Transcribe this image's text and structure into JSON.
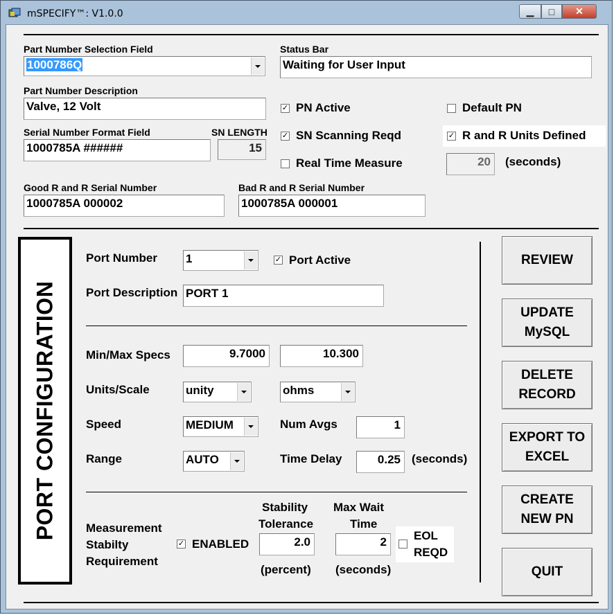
{
  "window": {
    "title": "mSPECIFY™: V1.0.0",
    "minimize_glyph": "▁",
    "maximize_glyph": "□",
    "close_glyph": "✕",
    "icon": "app-icon"
  },
  "header": {
    "part_number_label": "Part Number Selection Field",
    "part_number_value": "1000786Q",
    "status_bar_label": "Status Bar",
    "status_bar_value": "Waiting for User Input",
    "pn_description_label": "Part Number Description",
    "pn_description_value": "Valve, 12 Volt",
    "serial_format_label": "Serial Number Format Field",
    "serial_format_value": "1000785A ######",
    "sn_length_label": "SN LENGTH",
    "sn_length_value": "15",
    "good_rr_label": "Good R and R Serial Number",
    "good_rr_value": "1000785A 000002",
    "bad_rr_label": "Bad R and R Serial Number",
    "bad_rr_value": "1000785A 000001",
    "pn_active_label": "PN Active",
    "pn_active_checked": true,
    "default_pn_label": "Default PN",
    "default_pn_checked": false,
    "sn_scanning_label": "SN Scanning Reqd",
    "sn_scanning_checked": true,
    "rr_units_label": "R and R Units Defined",
    "rr_units_checked": true,
    "real_time_label": "Real Time Measure",
    "real_time_checked": false,
    "rr_seconds_value": "20",
    "rr_seconds_unit": "(seconds)"
  },
  "port_config": {
    "heading": "PORT CONFIGURATION",
    "port_number_label": "Port Number",
    "port_number_value": "1",
    "port_active_label": "Port Active",
    "port_active_checked": true,
    "port_description_label": "Port Description",
    "port_description_value": "PORT 1",
    "min_max_label": "Min/Max Specs",
    "min_value": "9.7000",
    "max_value": "10.300",
    "units_scale_label": "Units/Scale",
    "scale_value": "unity",
    "units_value": "ohms",
    "speed_label": "Speed",
    "speed_value": "MEDIUM",
    "num_avgs_label": "Num Avgs",
    "num_avgs_value": "1",
    "range_label": "Range",
    "range_value": "AUTO",
    "time_delay_label": "Time Delay",
    "time_delay_value": "0.25",
    "time_delay_unit": "(seconds)",
    "stability_label_1": "Measurement",
    "stability_label_2": "Stabilty",
    "stability_label_3": "Requirement",
    "enabled_label": "ENABLED",
    "enabled_checked": true,
    "stab_tol_label_1": "Stability",
    "stab_tol_label_2": "Tolerance",
    "stab_tol_value": "2.0",
    "stab_tol_unit": "(percent)",
    "max_wait_label_1": "Max Wait",
    "max_wait_label_2": "Time",
    "max_wait_value": "2",
    "max_wait_unit": "(seconds)",
    "eol_label_1": "EOL",
    "eol_label_2": "REQD",
    "eol_checked": false
  },
  "buttons": {
    "review": "REVIEW",
    "update_mysql": "UPDATE\nMySQL",
    "delete_record": "DELETE\nRECORD",
    "export_excel": "EXPORT TO\nEXCEL",
    "create_pn": "CREATE\nNEW PN",
    "quit": "QUIT"
  },
  "colors": {
    "titlebar": "#aac3db",
    "client_bg": "#f0f0f0",
    "selection": "#3399ff",
    "close_button": "#c43e2a"
  }
}
